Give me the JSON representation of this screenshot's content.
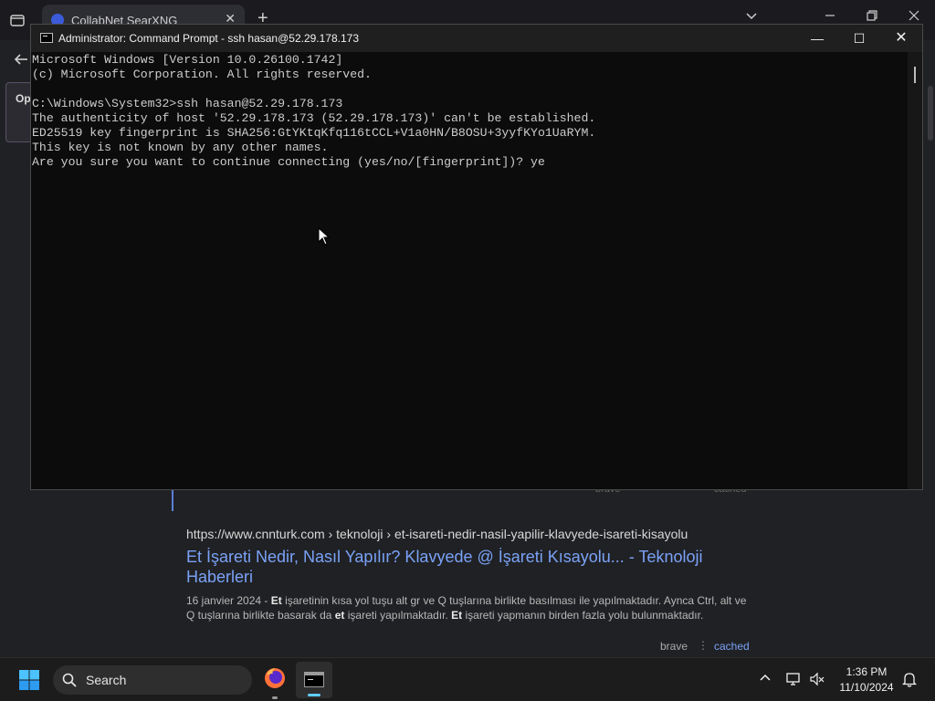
{
  "browser": {
    "tab_title": "CollabNet SearXNG",
    "tab_close": "✕",
    "new_tab": "+",
    "left_card_text": "Op",
    "results": {
      "faint_source": "brave",
      "faint_cached": "cached",
      "url_domain": "https://www.cnnturk.com",
      "url_path": "› teknoloji › et-isareti-nedir-nasil-yapilir-klavyede-isareti-kisayolu",
      "title": "Et İşareti Nedir, Nasıl Yapılır? Klavyede @ İşareti Kısayolu... - Teknoloji Haberleri",
      "snippet_date": "16 janvier 2024 - ",
      "snippet_parts": [
        {
          "text": "Et",
          "bold": true
        },
        {
          "text": " işaretinin kısa yol tuşu alt gr ve Q tuşlarına birlikte basılması ile yapılmaktadır. Aynca Ctrl, alt ve Q tuşlarına birlikte basarak da ",
          "bold": false
        },
        {
          "text": "et",
          "bold": true
        },
        {
          "text": " işareti yapılmaktadır. ",
          "bold": false
        },
        {
          "text": "Et",
          "bold": true
        },
        {
          "text": " işareti yapmanın birden fazla yolu bulunmaktadır.",
          "bold": false
        }
      ],
      "source": "brave",
      "separator": "⋮",
      "cached": "cached"
    }
  },
  "cmd": {
    "title": "Administrator: Command Prompt - ssh  hasan@52.29.178.173",
    "minimize": "—",
    "maximize": "☐",
    "close": "✕",
    "lines": [
      "Microsoft Windows [Version 10.0.26100.1742]",
      "(c) Microsoft Corporation. All rights reserved.",
      "",
      "C:\\Windows\\System32>ssh hasan@52.29.178.173",
      "The authenticity of host '52.29.178.173 (52.29.178.173)' can't be established.",
      "ED25519 key fingerprint is SHA256:GtYKtqKfq116tCCL+V1a0HN/B8OSU+3yyfKYo1UaRYM.",
      "This key is not known by any other names.",
      "Are you sure you want to continue connecting (yes/no/[fingerprint])? ye"
    ]
  },
  "taskbar": {
    "search_label": "Search",
    "time": "1:36 PM",
    "date": "11/10/2024"
  }
}
